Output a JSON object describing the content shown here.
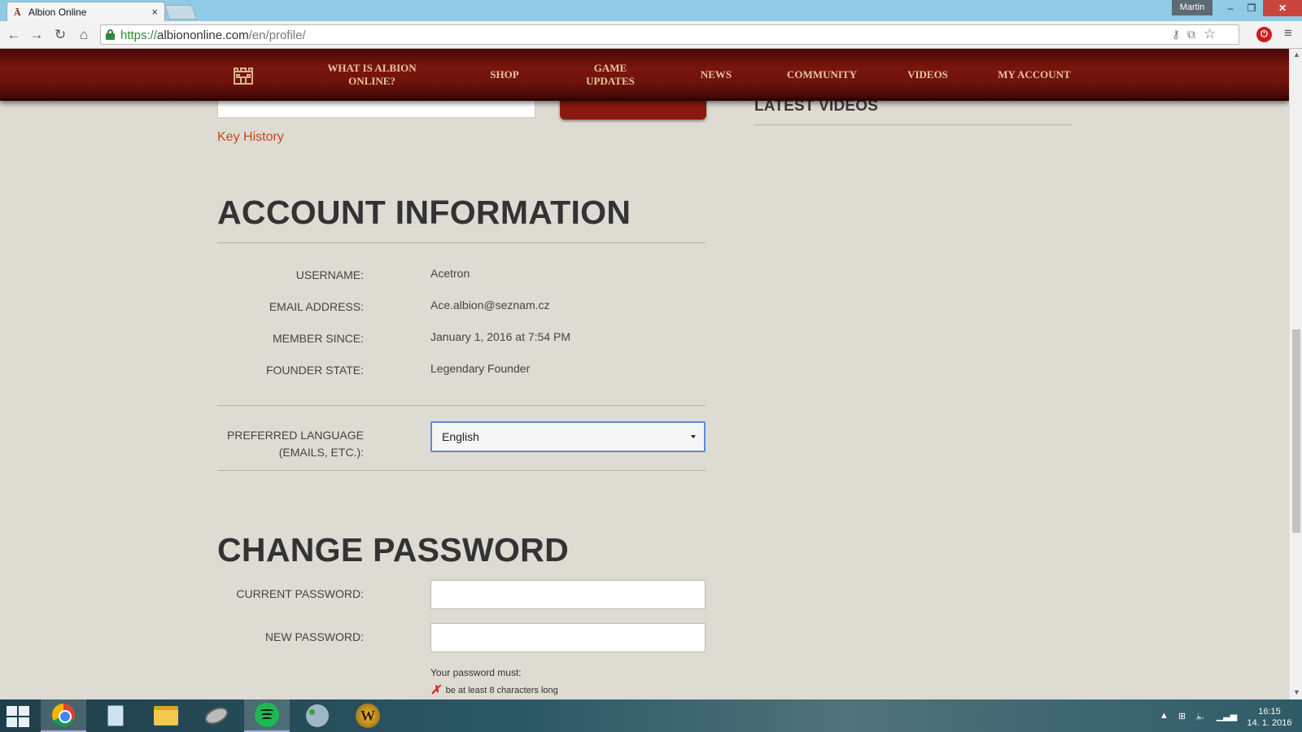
{
  "browser": {
    "tab_title": "Albion Online",
    "tab_close": "×",
    "profile_name": "Martin",
    "window_controls": {
      "minimize": "–",
      "maximize": "❐",
      "close": "✕"
    },
    "url_scheme": "https://",
    "url_host": "albiononline.com",
    "url_path": "/en/profile/",
    "nav_icons": {
      "back": "←",
      "forward": "→",
      "reload": "↻",
      "home": "⌂",
      "menu": "≡",
      "star": "☆",
      "key": "⚷",
      "translate": "⧉"
    }
  },
  "site_nav": {
    "items": [
      {
        "label": "WHAT IS ALBION ONLINE?"
      },
      {
        "label": "SHOP"
      },
      {
        "label": "GAME UPDATES"
      },
      {
        "label": "NEWS"
      },
      {
        "label": "COMMUNITY"
      },
      {
        "label": "VIDEOS"
      },
      {
        "label": "MY ACCOUNT"
      }
    ]
  },
  "sidebar": {
    "latest_videos_title": "LATEST VIDEOS"
  },
  "key_history_link": "Key History",
  "account": {
    "title": "ACCOUNT INFORMATION",
    "fields": [
      {
        "label": "USERNAME:",
        "value": "Acetron"
      },
      {
        "label": "EMAIL ADDRESS:",
        "value": "Ace.albion@seznam.cz"
      },
      {
        "label": "MEMBER SINCE:",
        "value": "January 1, 2016 at 7:54 PM"
      },
      {
        "label": "FOUNDER STATE:",
        "value": "Legendary Founder"
      }
    ],
    "language": {
      "label_line1": "PREFERRED LANGUAGE",
      "label_line2": "(EMAILS, ETC.):",
      "selected": "English"
    }
  },
  "password": {
    "title": "CHANGE PASSWORD",
    "current_label": "CURRENT PASSWORD:",
    "new_label": "NEW PASSWORD:",
    "requirements_intro": "Your password must:",
    "requirements": [
      "be at least 8 characters long"
    ],
    "requirement_fail_mark": "✗"
  },
  "taskbar": {
    "clock_time": "16:15",
    "clock_date": "14. 1. 2016",
    "wow_letter": "W"
  }
}
